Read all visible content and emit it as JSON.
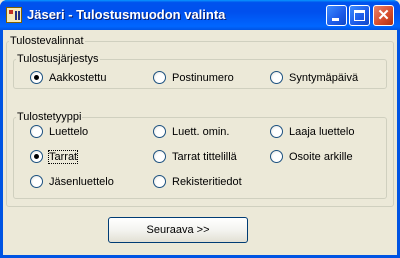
{
  "window": {
    "title": "Jäseri - Tulostusmuodon valinta"
  },
  "groups": {
    "outer_legend": "Tulostevalinnat",
    "order": {
      "legend": "Tulostusjärjestys",
      "options": [
        "Aakkostettu",
        "Postinumero",
        "Syntymäpäivä"
      ],
      "selected": "Aakkostettu"
    },
    "type": {
      "legend": "Tulostetyyppi",
      "options": [
        "Luettelo",
        "Luett. omin.",
        "Laaja luettelo",
        "Tarrat",
        "Tarrat tittelillä",
        "Osoite arkille",
        "Jäsenluettelo",
        "Rekisteritiedot"
      ],
      "selected": "Tarrat"
    }
  },
  "buttons": {
    "next": "Seuraava >>"
  }
}
